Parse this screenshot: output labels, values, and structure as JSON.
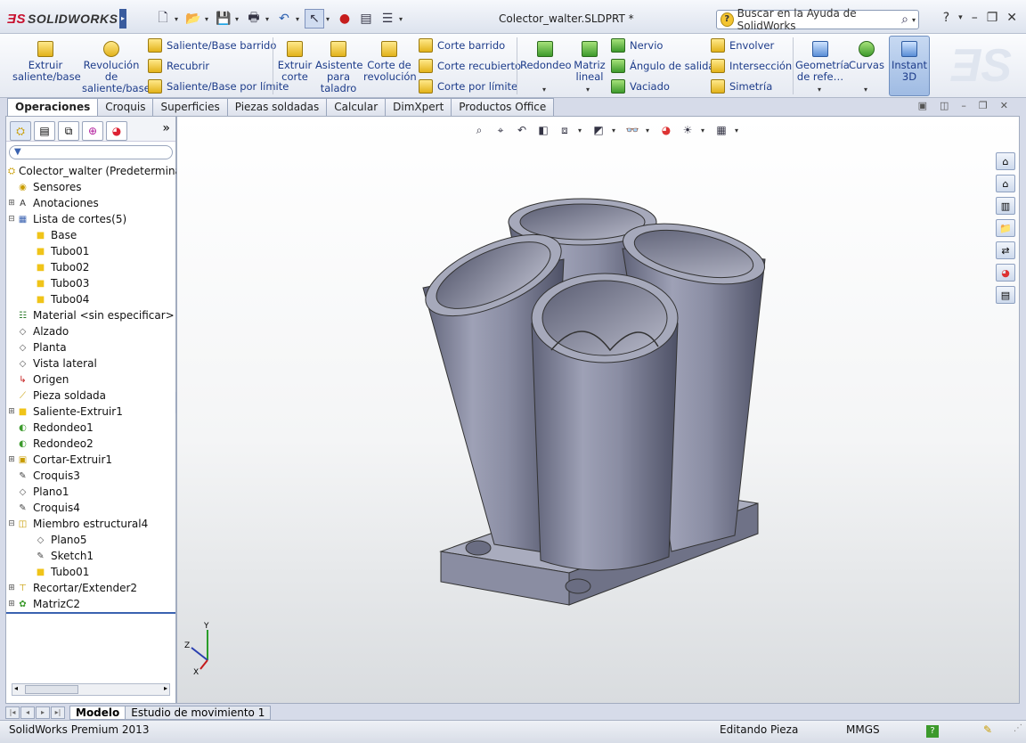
{
  "app": {
    "brand": "SOLIDWORKS",
    "doc_title": "Colector_walter.SLDPRT *"
  },
  "search": {
    "placeholder": "Buscar en la Ayuda de SolidWorks"
  },
  "ribbon": {
    "extruir": "Extruir saliente/base",
    "revolucion": "Revolución de saliente/base",
    "saliente_barrido": "Saliente/Base barrido",
    "recubrir": "Recubrir",
    "saliente_limite": "Saliente/Base por límite",
    "extruir_corte": "Extruir corte",
    "asistente": "Asistente para taladro",
    "corte_revolucion": "Corte de revolución",
    "corte_barrido": "Corte barrido",
    "corte_recubierto": "Corte recubierto",
    "corte_limite": "Corte por límite",
    "redondeo": "Redondeo",
    "matriz": "Matriz lineal",
    "nervio": "Nervio",
    "angulo": "Ángulo de salida",
    "vaciado": "Vaciado",
    "envolver": "Envolver",
    "interseccion": "Intersección",
    "simetria": "Simetría",
    "geometria": "Geometría de refe…",
    "curvas": "Curvas",
    "instant": "Instant 3D"
  },
  "tabs": [
    "Operaciones",
    "Croquis",
    "Superficies",
    "Piezas soldadas",
    "Calcular",
    "DimXpert",
    "Productos Office"
  ],
  "tree": {
    "root": "Colector_walter (Predeterminado",
    "items": [
      {
        "label": "Sensores",
        "level": 1,
        "icon": "sensor"
      },
      {
        "label": "Anotaciones",
        "level": 1,
        "icon": "annotation",
        "exp": "+"
      },
      {
        "label": "Lista de cortes(5)",
        "level": 1,
        "icon": "cutlist",
        "exp": "−"
      },
      {
        "label": "Base",
        "level": 2,
        "icon": "body"
      },
      {
        "label": "Tubo01",
        "level": 2,
        "icon": "body"
      },
      {
        "label": "Tubo02",
        "level": 2,
        "icon": "body"
      },
      {
        "label": "Tubo03",
        "level": 2,
        "icon": "body"
      },
      {
        "label": "Tubo04",
        "level": 2,
        "icon": "body"
      },
      {
        "label": "Material <sin especificar>",
        "level": 1,
        "icon": "material"
      },
      {
        "label": "Alzado",
        "level": 1,
        "icon": "plane"
      },
      {
        "label": "Planta",
        "level": 1,
        "icon": "plane"
      },
      {
        "label": "Vista lateral",
        "level": 1,
        "icon": "plane"
      },
      {
        "label": "Origen",
        "level": 1,
        "icon": "origin"
      },
      {
        "label": "Pieza soldada",
        "level": 1,
        "icon": "weldment"
      },
      {
        "label": "Saliente-Extruir1",
        "level": 1,
        "icon": "extrude",
        "exp": "+"
      },
      {
        "label": "Redondeo1",
        "level": 1,
        "icon": "fillet"
      },
      {
        "label": "Redondeo2",
        "level": 1,
        "icon": "fillet"
      },
      {
        "label": "Cortar-Extruir1",
        "level": 1,
        "icon": "cut",
        "exp": "+"
      },
      {
        "label": "Croquis3",
        "level": 1,
        "icon": "sketch"
      },
      {
        "label": "Plano1",
        "level": 1,
        "icon": "plane"
      },
      {
        "label": "Croquis4",
        "level": 1,
        "icon": "sketch"
      },
      {
        "label": "Miembro estructural4",
        "level": 1,
        "icon": "struct",
        "exp": "−"
      },
      {
        "label": "Plano5",
        "level": 2,
        "icon": "plane"
      },
      {
        "label": "Sketch1",
        "level": 2,
        "icon": "sketch"
      },
      {
        "label": "Tubo01",
        "level": 2,
        "icon": "body"
      },
      {
        "label": "Recortar/Extender2",
        "level": 1,
        "icon": "trim",
        "exp": "+"
      },
      {
        "label": "MatrizC2",
        "level": 1,
        "icon": "pattern",
        "exp": "+"
      }
    ]
  },
  "triad": {
    "x": "X",
    "y": "Y",
    "z": "Z"
  },
  "bottom_tabs": [
    "Modelo",
    "Estudio de movimiento 1"
  ],
  "status": {
    "product": "SolidWorks Premium 2013",
    "mode": "Editando Pieza",
    "units": "MMGS"
  }
}
